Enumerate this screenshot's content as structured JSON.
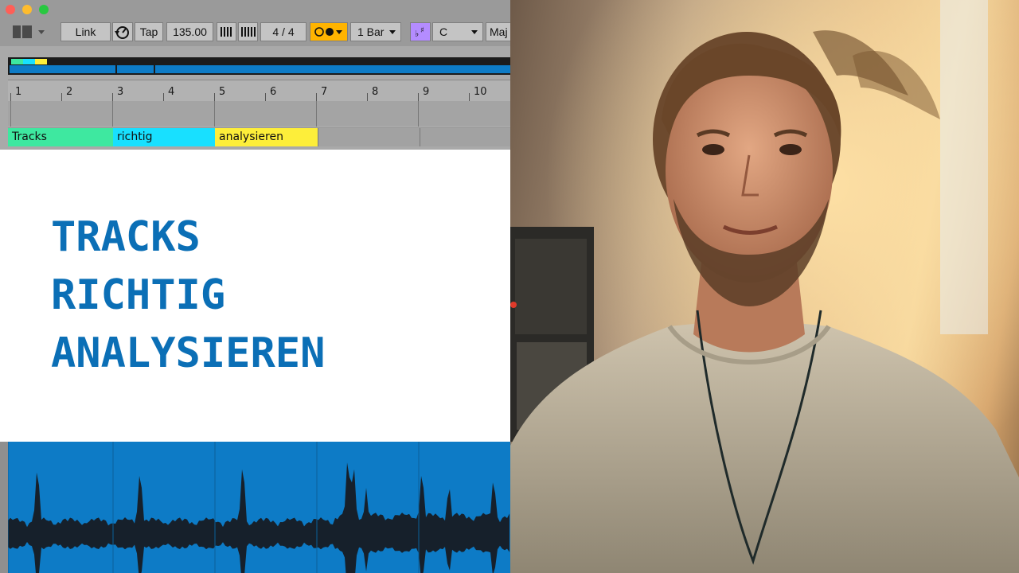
{
  "controlbar": {
    "link": "Link",
    "tap": "Tap",
    "tempo": "135.00",
    "signature": "4 / 4",
    "quantize": "1 Bar",
    "key_root": "C",
    "scale": "Maj"
  },
  "ruler": {
    "bars": [
      "1",
      "2",
      "3",
      "4",
      "5",
      "6",
      "7",
      "8",
      "9",
      "10"
    ]
  },
  "locators": [
    "Tracks",
    "richtig",
    "analysieren"
  ],
  "overlay": {
    "title_lines": [
      "TRACKS",
      "RICHTIG",
      "ANALYSIEREN"
    ]
  },
  "colors": {
    "title_blue": "#0b6fb6",
    "clip_green": "#3ee8a0",
    "clip_cyan": "#18e0ff",
    "clip_yellow": "#fdee3a",
    "waveform_bg": "#0d7bc6",
    "quantize_orange": "#ffb400",
    "scale_purple": "#b48cff"
  },
  "icons": {
    "view": "split-view-icon",
    "metronome": "metronome-icon",
    "follow": "follow-icon",
    "record_quantize": "record-circle-icon",
    "key": "flat-sharp-icon"
  }
}
